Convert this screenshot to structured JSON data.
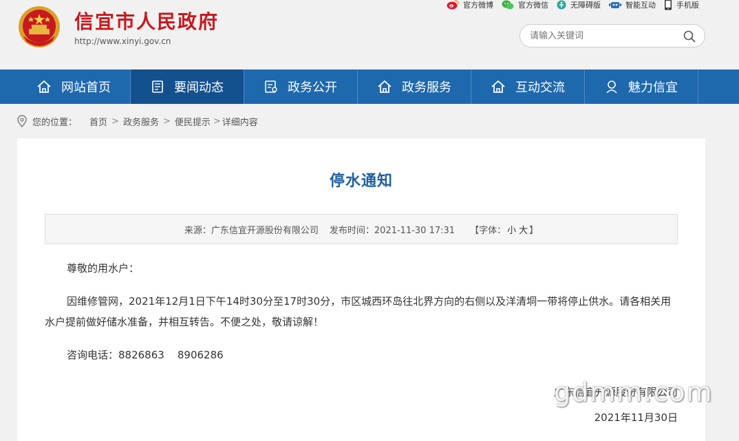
{
  "header": {
    "site_title": "信宜市人民政府",
    "site_url": "http://www.xinyi.gov.cn",
    "top_links": [
      {
        "label": "官方微博",
        "icon": "weibo-icon"
      },
      {
        "label": "官方微信",
        "icon": "wechat-icon"
      },
      {
        "label": "无障碍版",
        "icon": "accessibility-icon"
      },
      {
        "label": "智能互动",
        "icon": "robot-icon"
      },
      {
        "label": "手机版",
        "icon": "mobile-icon"
      }
    ],
    "search_placeholder": "请输入关键词"
  },
  "nav": {
    "items": [
      {
        "label": "网站首页",
        "icon": "home-icon"
      },
      {
        "label": "要闻动态",
        "icon": "news-icon",
        "active": true
      },
      {
        "label": "政务公开",
        "icon": "document-icon"
      },
      {
        "label": "政务服务",
        "icon": "home-icon"
      },
      {
        "label": "互动交流",
        "icon": "home-icon"
      },
      {
        "label": "魅力信宜",
        "icon": "person-icon"
      }
    ]
  },
  "breadcrumb": {
    "label": "您的位置：",
    "items": [
      "首页",
      "政务服务",
      "便民提示",
      "详细内容"
    ]
  },
  "article": {
    "title": "停水通知",
    "source_label": "来源：",
    "source": "广东信宜开源股份有限公司",
    "time_label": "发布时间：",
    "time": "2021-11-30 17:31",
    "font_label": "【字体：",
    "font_small": "小",
    "font_large": "大",
    "font_end": "】",
    "greeting": "尊敬的用水户：",
    "paragraph": "因维修管网，2021年12月1日下午14时30分至17时30分，市区城西环岛往北界方向的右侧以及洋清垌一带将停止供水。请各相关用水户提前做好储水准备，并相互转告。不便之处，敬请谅解！",
    "contact": "咨询电话：8826863    8906286",
    "signature_org": "广东信宜开源股份有限公司",
    "signature_date": "2021年11月30日"
  },
  "watermark": "gdmm.com",
  "colors": {
    "brand_red": "#c8191e",
    "nav_blue": "#1e68ae",
    "nav_active": "#13508e",
    "title_blue": "#1e5fa0"
  }
}
